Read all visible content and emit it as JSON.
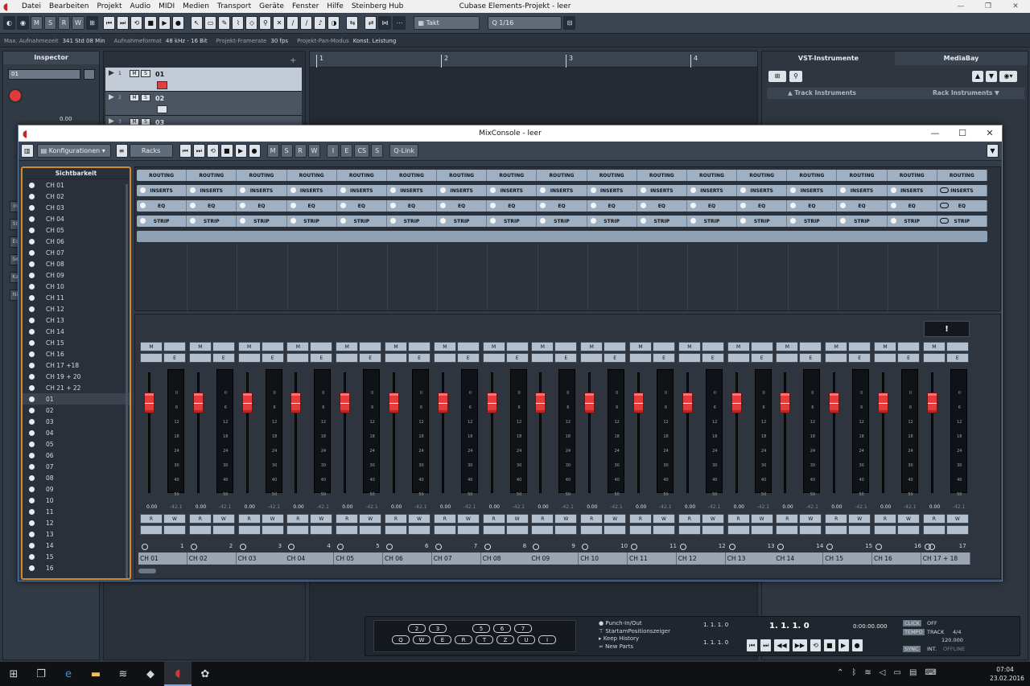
{
  "app": {
    "title": "Cubase Elements-Projekt - leer",
    "menu": [
      "Datei",
      "Bearbeiten",
      "Projekt",
      "Audio",
      "MIDI",
      "Medien",
      "Transport",
      "Geräte",
      "Fenster",
      "Hilfe",
      "Steinberg Hub"
    ]
  },
  "toolbar": {
    "msrw": [
      "M",
      "S",
      "R",
      "W"
    ],
    "snap_mode": "Takt",
    "quantize": "1/16"
  },
  "status": {
    "rec_time_label": "Max. Aufnahmezeit",
    "rec_time": "341 Std 08 Min",
    "rec_format_label": "Aufnahmeformat",
    "rec_format": "48 kHz - 16 Bit",
    "framerate_label": "Projekt-Framerate",
    "framerate": "30 fps",
    "pan_label": "Projekt-Pan-Modus",
    "pan": "Konst. Leistung"
  },
  "inspector": {
    "title": "Inspector",
    "track": "01",
    "value": "0.00",
    "side_tabs": [
      "In",
      "St",
      "Ec",
      "Se",
      "Ka",
      "Ni"
    ]
  },
  "tracks": [
    {
      "num": "1",
      "name": "01"
    },
    {
      "num": "2",
      "name": "02"
    },
    {
      "num": "3",
      "name": "03"
    }
  ],
  "ruler": {
    "bars": [
      "1",
      "2",
      "3",
      "4"
    ]
  },
  "right": {
    "tabs": [
      "VST-Instrumente",
      "MediaBay"
    ],
    "track_instruments": "Track Instruments",
    "rack_instruments": "Rack Instruments"
  },
  "mix": {
    "title": "MixConsole - leer",
    "config": "Konfigurationen",
    "racks": "Racks",
    "msrw": [
      "M",
      "S",
      "R",
      "W"
    ],
    "iecs": [
      "I",
      "E",
      "CS",
      "S"
    ],
    "qlink": "Q-Link",
    "visibility_title": "Sichtbarkeit",
    "visibility_items": [
      "CH 01",
      "CH 02",
      "CH 03",
      "CH 04",
      "CH 05",
      "CH 06",
      "CH 07",
      "CH 08",
      "CH 09",
      "CH 10",
      "CH 11",
      "CH 12",
      "CH 13",
      "CH 14",
      "CH 15",
      "CH 16",
      "CH 17 +18",
      "CH 19 + 20",
      "CH 21 + 22",
      "01",
      "02",
      "03",
      "04",
      "05",
      "06",
      "07",
      "08",
      "09",
      "10",
      "11",
      "12",
      "13",
      "14",
      "15",
      "16"
    ],
    "selected_item": "01",
    "rack_rows": [
      "ROUTING",
      "INSERTS",
      "EQ",
      "STRIP"
    ],
    "meter_scale": [
      "0",
      "6",
      "12",
      "18",
      "24",
      "30",
      "40",
      "50"
    ],
    "fader_value": "0.00",
    "peak_value": "-42.1",
    "buttons": {
      "m": "M",
      "e": "E",
      "r": "R",
      "w": "W"
    },
    "channels": [
      {
        "name": "CH 01",
        "num": "1"
      },
      {
        "name": "CH 02",
        "num": "2"
      },
      {
        "name": "CH 03",
        "num": "3"
      },
      {
        "name": "CH 04",
        "num": "4"
      },
      {
        "name": "CH 05",
        "num": "5"
      },
      {
        "name": "CH 06",
        "num": "6"
      },
      {
        "name": "CH 07",
        "num": "7"
      },
      {
        "name": "CH 08",
        "num": "8"
      },
      {
        "name": "CH 09",
        "num": "9"
      },
      {
        "name": "CH 10",
        "num": "10"
      },
      {
        "name": "CH 11",
        "num": "11"
      },
      {
        "name": "CH 12",
        "num": "12"
      },
      {
        "name": "CH 13",
        "num": "13"
      },
      {
        "name": "CH 14",
        "num": "14"
      },
      {
        "name": "CH 15",
        "num": "15"
      },
      {
        "name": "CH 16",
        "num": "16"
      },
      {
        "name": "CH 17 + 18",
        "num": "17"
      }
    ],
    "fader_level": 0.25
  },
  "transport": {
    "keys_top": [
      "2",
      "3",
      "5",
      "6",
      "7"
    ],
    "keys_bottom": [
      "Q",
      "W",
      "E",
      "R",
      "T",
      "Z",
      "U",
      "I"
    ],
    "punch_in": "Punch-In/Out",
    "start_pos": "StartamPositionszeiger",
    "keep_history": "Keep History",
    "new_parts": "New Parts",
    "locator_l": "1. 1. 1. 0",
    "locator_r": "1. 1. 1. 0",
    "position": "1. 1. 1. 0",
    "time": "0:00:00.000",
    "click": "CLICK",
    "click_state": "OFF",
    "tempo": "TEMPO",
    "tempo_mode": "TRACK",
    "signature": "4/4",
    "bpm": "120.000",
    "sync": "SYNC",
    "sync_mode": "INT.",
    "sync_state": "OFFLINE"
  },
  "taskbar": {
    "time": "07:04",
    "date": "23.02.2016"
  }
}
